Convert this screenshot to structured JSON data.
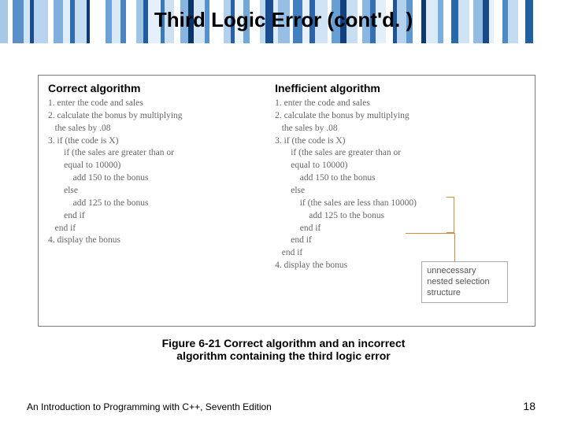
{
  "title": "Third Logic Error (cont'd. )",
  "correct": {
    "heading": "Correct algorithm",
    "lines": "1. enter the code and sales\n2. calculate the bonus by multiplying\n   the sales by .08\n3. if (the code is X)\n       if (the sales are greater than or\n       equal to 10000)\n           add 150 to the bonus\n       else\n           add 125 to the bonus\n       end if\n   end if\n4. display the bonus"
  },
  "inefficient": {
    "heading": "Inefficient algorithm",
    "lines": "1. enter the code and sales\n2. calculate the bonus by multiplying\n   the sales by .08\n3. if (the code is X)\n       if (the sales are greater than or\n       equal to 10000)\n           add 150 to the bonus\n       else\n           if (the sales are less than 10000)\n               add 125 to the bonus\n           end if\n       end if\n   end if\n4. display the bonus"
  },
  "callout": "unnecessary\nnested selection\nstructure",
  "caption_line1": "Figure 6-21 Correct algorithm and an incorrect",
  "caption_line2": "algorithm containing the third logic error",
  "footer_left": "An Introduction to Programming with C++, Seventh Edition",
  "page_number": "18",
  "bars": [
    {
      "w": 10,
      "c": "#a8c8e8"
    },
    {
      "w": 6,
      "c": "#ffffff"
    },
    {
      "w": 14,
      "c": "#5a8fc7"
    },
    {
      "w": 8,
      "c": "#d0e4f5"
    },
    {
      "w": 5,
      "c": "#1a4d8f"
    },
    {
      "w": 18,
      "c": "#b8d4ee"
    },
    {
      "w": 7,
      "c": "#ffffff"
    },
    {
      "w": 12,
      "c": "#7fb0dd"
    },
    {
      "w": 9,
      "c": "#e0eef9"
    },
    {
      "w": 6,
      "c": "#2f6db3"
    },
    {
      "w": 15,
      "c": "#c5ddf2"
    },
    {
      "w": 4,
      "c": "#0d3a73"
    },
    {
      "w": 20,
      "c": "#ffffff"
    },
    {
      "w": 8,
      "c": "#6ba3d6"
    },
    {
      "w": 11,
      "c": "#d9e9f6"
    },
    {
      "w": 7,
      "c": "#4a85c2"
    },
    {
      "w": 13,
      "c": "#ffffff"
    },
    {
      "w": 9,
      "c": "#a0c4e6"
    },
    {
      "w": 6,
      "c": "#1f5ca0"
    },
    {
      "w": 16,
      "c": "#e5f0fa"
    },
    {
      "w": 5,
      "c": "#3d78b8"
    },
    {
      "w": 12,
      "c": "#cde1f3"
    },
    {
      "w": 8,
      "c": "#ffffff"
    },
    {
      "w": 10,
      "c": "#87b5e0"
    },
    {
      "w": 7,
      "c": "#0a3368"
    },
    {
      "w": 14,
      "c": "#d4e6f5"
    },
    {
      "w": 6,
      "c": "#5592cb"
    },
    {
      "w": 18,
      "c": "#ffffff"
    },
    {
      "w": 9,
      "c": "#b0d0ec"
    },
    {
      "w": 5,
      "c": "#285fa6"
    },
    {
      "w": 11,
      "c": "#ebf3fb"
    },
    {
      "w": 8,
      "c": "#73a9d9"
    },
    {
      "w": 13,
      "c": "#ffffff"
    },
    {
      "w": 7,
      "c": "#c0daf0"
    },
    {
      "w": 10,
      "c": "#1a4d8f"
    },
    {
      "w": 6,
      "c": "#dfecf8"
    },
    {
      "w": 15,
      "c": "#97bfe4"
    },
    {
      "w": 4,
      "c": "#ffffff"
    },
    {
      "w": 12,
      "c": "#4280bf"
    },
    {
      "w": 9,
      "c": "#e8f1fa"
    },
    {
      "w": 7,
      "c": "#2a63aa"
    },
    {
      "w": 16,
      "c": "#d0e4f5"
    },
    {
      "w": 5,
      "c": "#ffffff"
    },
    {
      "w": 11,
      "c": "#669fd3"
    },
    {
      "w": 8,
      "c": "#133f7d"
    },
    {
      "w": 14,
      "c": "#c8dff2"
    },
    {
      "w": 6,
      "c": "#ffffff"
    },
    {
      "w": 10,
      "c": "#8ab7e1"
    },
    {
      "w": 7,
      "c": "#3570b0"
    },
    {
      "w": 13,
      "c": "#e2eef8"
    },
    {
      "w": 9,
      "c": "#ffffff"
    },
    {
      "w": 5,
      "c": "#1d5498"
    },
    {
      "w": 12,
      "c": "#b5d2ed"
    },
    {
      "w": 8,
      "c": "#5e99ce"
    },
    {
      "w": 11,
      "c": "#ffffff"
    },
    {
      "w": 6,
      "c": "#0f3870"
    },
    {
      "w": 15,
      "c": "#daeaf6"
    },
    {
      "w": 7,
      "c": "#7aade0"
    },
    {
      "w": 10,
      "c": "#ffffff"
    },
    {
      "w": 9,
      "c": "#276aab"
    },
    {
      "w": 14,
      "c": "#cfe3f4"
    },
    {
      "w": 5,
      "c": "#ffffff"
    },
    {
      "w": 12,
      "c": "#93bce3"
    },
    {
      "w": 8,
      "c": "#174888"
    },
    {
      "w": 6,
      "c": "#e6f0fa"
    },
    {
      "w": 11,
      "c": "#ffffff"
    },
    {
      "w": 7,
      "c": "#4e8ac5"
    },
    {
      "w": 13,
      "c": "#c3dcf1"
    },
    {
      "w": 9,
      "c": "#ffffff"
    },
    {
      "w": 10,
      "c": "#2260a3"
    }
  ]
}
